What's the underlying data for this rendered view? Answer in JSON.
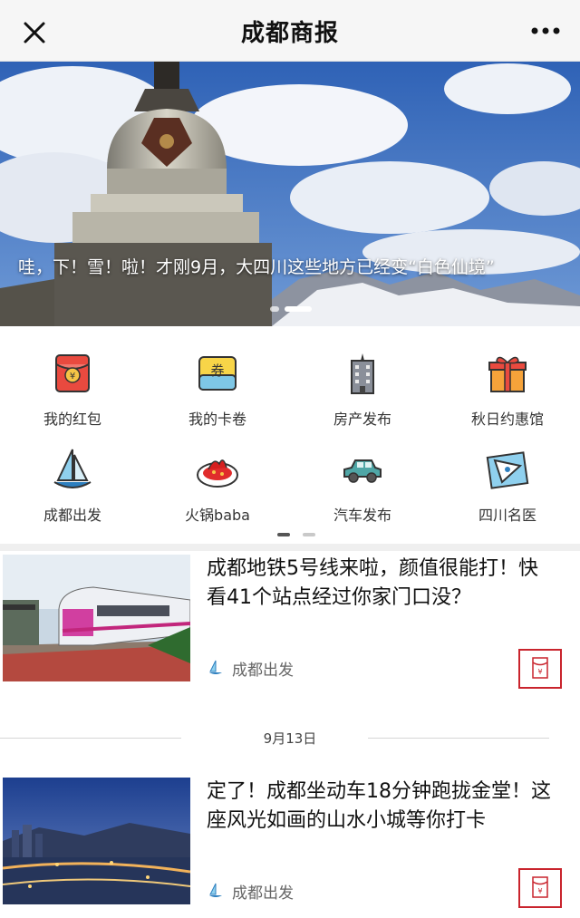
{
  "header": {
    "title": "成都商报"
  },
  "banner": {
    "caption": "哇，下！雪！啦！才刚9月，大四川这些地方已经变“白色仙境”"
  },
  "grid": {
    "items": [
      {
        "label": "我的红包",
        "icon": "red-envelope-icon"
      },
      {
        "label": "我的卡卷",
        "icon": "coupon-icon"
      },
      {
        "label": "房产发布",
        "icon": "building-icon"
      },
      {
        "label": "秋日约惠馆",
        "icon": "gift-box-icon"
      },
      {
        "label": "成都出发",
        "icon": "sailboat-icon"
      },
      {
        "label": "火锅baba",
        "icon": "hotpot-icon"
      },
      {
        "label": "汽车发布",
        "icon": "car-icon"
      },
      {
        "label": "四川名医",
        "icon": "map-pin-icon"
      }
    ]
  },
  "articles": [
    {
      "headline": "成都地铁5号线来啦，颜值很能打！快看41个站点经过你家门口没？",
      "source": "成都出发"
    },
    {
      "headline": "定了！成都坐动车18分钟跑拢金堂！这座风光如画的山水小城等你打卡",
      "source": "成都出发"
    }
  ],
  "date_separator": "9月13日",
  "colors": {
    "accent_red": "#c9242d",
    "header_bg": "#f6f6f6"
  }
}
